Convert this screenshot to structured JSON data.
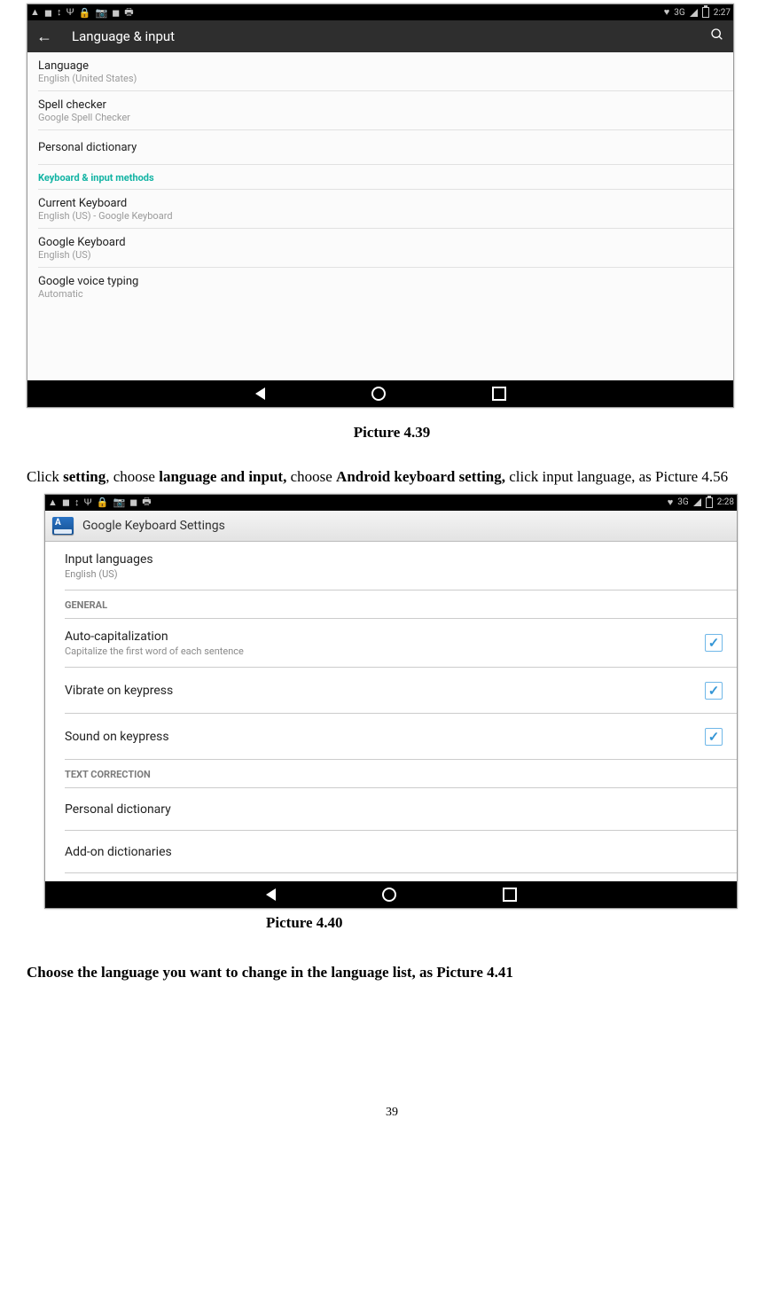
{
  "screenshot1": {
    "statusbar": {
      "network": "3G",
      "time": "2:27"
    },
    "appbar": {
      "title": "Language & input"
    },
    "items": [
      {
        "title": "Language",
        "sub": "English (United States)"
      },
      {
        "title": "Spell checker",
        "sub": "Google Spell Checker"
      },
      {
        "title": "Personal dictionary",
        "sub": ""
      }
    ],
    "section": "Keyboard & input methods",
    "items2": [
      {
        "title": "Current Keyboard",
        "sub": "English (US) - Google Keyboard"
      },
      {
        "title": "Google Keyboard",
        "sub": "English (US)"
      },
      {
        "title": "Google voice typing",
        "sub": "Automatic"
      }
    ]
  },
  "caption1": "Picture 4.39",
  "paragraph": {
    "pre": "Click ",
    "b1": "setting",
    "mid1": ", choose ",
    "b2": "language and input,",
    "mid2": " choose ",
    "b3": "Android keyboard setting,",
    "post": " click input language, as Picture 4.56"
  },
  "screenshot2": {
    "statusbar": {
      "network": "3G",
      "time": "2:28"
    },
    "appbar": {
      "title": "Google Keyboard Settings"
    },
    "items_top": [
      {
        "title": "Input languages",
        "sub": "English (US)"
      }
    ],
    "section_general": "GENERAL",
    "items_general": [
      {
        "title": "Auto-capitalization",
        "sub": "Capitalize the first word of each sentence",
        "checked": true
      },
      {
        "title": "Vibrate on keypress",
        "sub": "",
        "checked": true
      },
      {
        "title": "Sound on keypress",
        "sub": "",
        "checked": true
      }
    ],
    "section_text": "TEXT CORRECTION",
    "items_text": [
      {
        "title": "Personal dictionary",
        "sub": ""
      },
      {
        "title": "Add-on dictionaries",
        "sub": ""
      }
    ]
  },
  "caption2": "Picture 4.40",
  "instruction2": "Choose the language you want to change in the language list, as Picture 4.41",
  "page_number": "39"
}
